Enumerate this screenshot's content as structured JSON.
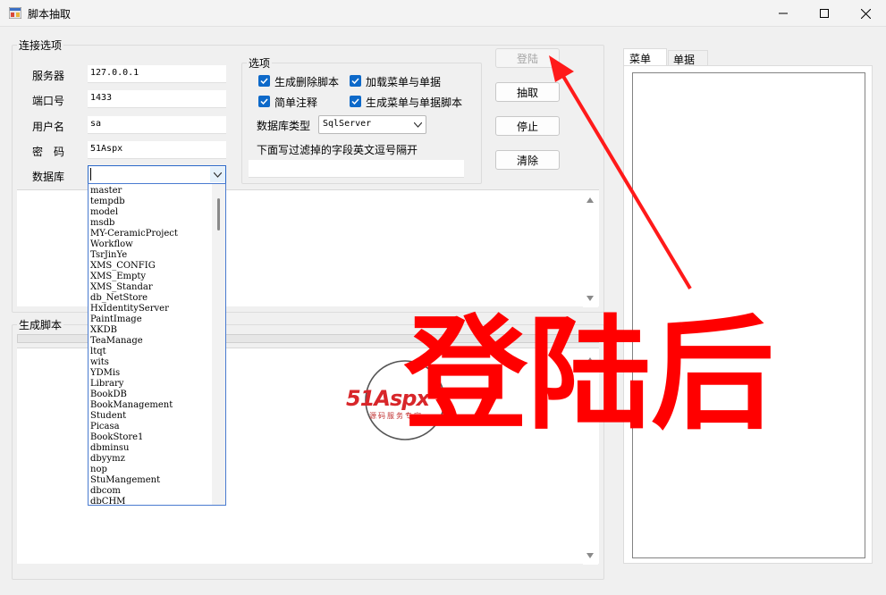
{
  "window": {
    "title": "脚本抽取"
  },
  "conn_group": {
    "title": "连接选项",
    "server_label": "服务器",
    "server_value": "127.0.0.1",
    "port_label": "端口号",
    "port_value": "1433",
    "user_label": "用户名",
    "user_value": "sa",
    "password_label": "密　码",
    "password_value": "51Aspx",
    "database_label": "数据库",
    "database_value": ""
  },
  "options_group": {
    "title": "选项",
    "checkboxes": [
      {
        "label": "生成删除脚本",
        "checked": true
      },
      {
        "label": "加载菜单与单据",
        "checked": true
      },
      {
        "label": "简单注释",
        "checked": true
      },
      {
        "label": "生成菜单与单据脚本",
        "checked": true
      }
    ],
    "dbtype_label": "数据库类型",
    "dbtype_value": "SqlServer",
    "filter_label": "下面写过滤掉的字段英文逗号隔开",
    "filter_value": ""
  },
  "buttons": {
    "login": "登陆",
    "extract": "抽取",
    "stop": "停止",
    "clear": "清除"
  },
  "script_group": {
    "title": "生成脚本"
  },
  "tabs": [
    "菜单",
    "单据"
  ],
  "database_list": [
    "master",
    "tempdb",
    "model",
    "msdb",
    "MY-CeramicProject",
    "Workflow",
    "TsrJinYe",
    "XMS_CONFIG",
    "XMS_Empty",
    "XMS_Standar",
    "db_NetStore",
    "HxIdentityServer",
    "PaintImage",
    "XKDB",
    "TeaManage",
    "ltqt",
    "wits",
    "YDMis",
    "Library",
    "BookDB",
    "BookManagement",
    "Student",
    "Picasa",
    "BookStore1",
    "dbminsu",
    "dbyymz",
    "nop",
    "StuMangement",
    "dbcom",
    "dbCHM"
  ],
  "watermark": {
    "brand": "51Aspx",
    "tagline": "源码服务专家"
  },
  "annotation": {
    "text": "登陆后"
  },
  "colors": {
    "accent": "#0d69c9",
    "annotation": "#ff0000"
  }
}
